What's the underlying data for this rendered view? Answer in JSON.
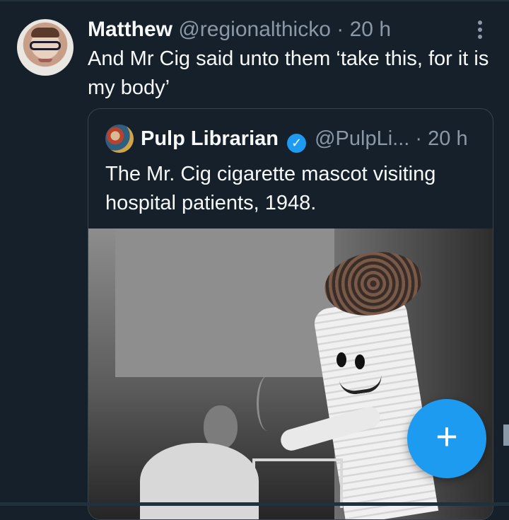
{
  "tweet": {
    "author_name": "Matthew",
    "handle": "@regionalthicko",
    "separator": "·",
    "time": "20 h",
    "text": "And Mr Cig said unto them ‘take this, for it is my body’"
  },
  "quoted_tweet": {
    "author_name": "Pulp Librarian",
    "verified_icon": "verified-checkmark",
    "handle": "@PulpLi...",
    "separator": "·",
    "time": "20 h",
    "text": "The Mr. Cig cigarette mascot visiting hospital patients, 1948."
  },
  "actions": {
    "compose_icon": "plus-icon",
    "compose_label": "+"
  },
  "icons": {
    "more": "vertical-more-icon"
  },
  "colors": {
    "background": "#15202b",
    "primary_text": "#f7f9f9",
    "secondary_text": "#8b98a5",
    "accent": "#1d9bf0",
    "border": "#38444d"
  }
}
